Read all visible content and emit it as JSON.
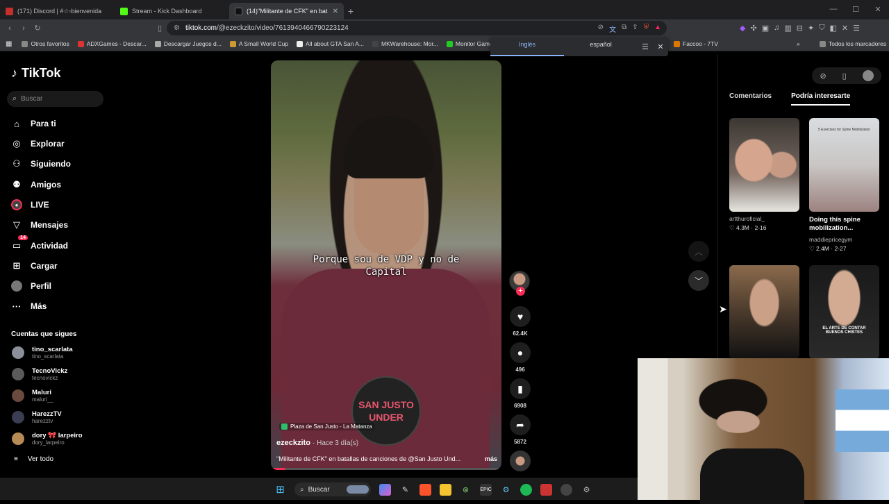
{
  "browser": {
    "tabs": [
      {
        "title": "(171) Discord | #☆▫bienvenida",
        "color": "#c4302b"
      },
      {
        "title": "Stream - Kick Dashboard",
        "color": "#53fc18"
      },
      {
        "title": "(14)\"Militante de CFK\" en bat",
        "color": "#111111",
        "active": true
      }
    ],
    "url_host": "tiktok.com",
    "url_path": "/@ezeckzito/video/7613940466790223124",
    "bookmarks": [
      "Otros favoritos",
      "ADXGames - Descar...",
      "Descargar Juegos d...",
      "A Small World Cup",
      "All about GTA San A...",
      "MKWarehouse: Mor...",
      "Monitor Gamer LE",
      "Faccoo - 7TV",
      "Todos los marcadores"
    ],
    "translate": {
      "from": "Inglés",
      "to": "español"
    }
  },
  "tiktok": {
    "logo": "TikTok",
    "search_placeholder": "Buscar",
    "nav": [
      {
        "label": "Para ti",
        "icon": "home-icon"
      },
      {
        "label": "Explorar",
        "icon": "compass-icon"
      },
      {
        "label": "Siguiendo",
        "icon": "following-icon"
      },
      {
        "label": "Amigos",
        "icon": "friends-icon"
      },
      {
        "label": "LIVE",
        "icon": "live-icon"
      },
      {
        "label": "Mensajes",
        "icon": "messages-icon"
      },
      {
        "label": "Actividad",
        "icon": "activity-icon",
        "badge": "14"
      },
      {
        "label": "Cargar",
        "icon": "upload-icon"
      },
      {
        "label": "Perfil",
        "icon": "profile-icon"
      },
      {
        "label": "Más",
        "icon": "more-icon"
      }
    ],
    "following_title": "Cuentas que sigues",
    "following": [
      {
        "name": "tino_scarlata",
        "handle": "tino_scarlata"
      },
      {
        "name": "TecnoVickz",
        "handle": "tecnovickz"
      },
      {
        "name": "Maluri",
        "handle": "maluri__"
      },
      {
        "name": "HarezzTV",
        "handle": "harezztv"
      },
      {
        "name": "dory 🎀 larpeiro",
        "handle": "dory_larpeiro"
      }
    ],
    "see_all": "Ver todo"
  },
  "video": {
    "subtitle_line1": "Porque sou de VDP y no de",
    "subtitle_line2": "Capital",
    "watermark_line1": "SAN JUSTO",
    "watermark_line2": "UNDER",
    "location": "Plaza de San Justo - La Matanza",
    "author": "ezeckzito",
    "posted": "· Hace 3 día(s)",
    "description": "\"Militante de CFK\" en batallas de canciones de @San Justo Und...",
    "more": "más",
    "progress": 0.06,
    "likes": "62.4K",
    "comments": "496",
    "saves": "6908",
    "shares": "5872"
  },
  "right_panel": {
    "tab_comments": "Comentarios",
    "tab_suggested": "Podría interesarte",
    "cards": [
      {
        "title": "",
        "user": "artthuroficial_",
        "likes": "4.3M",
        "date": "2-16"
      },
      {
        "title": "Doing this spine mobilization...",
        "thumb_text": "5 Exercises for Spine Mobilization",
        "user": "maddiepricegym",
        "likes": "2.4M",
        "date": "2-27"
      },
      {
        "title": "",
        "user": "",
        "likes": "",
        "date": ""
      },
      {
        "title": "",
        "thumb_text": "EL ARTE DE CONTAR BUENOS CHISTES",
        "user": "",
        "likes": "",
        "date": ""
      }
    ]
  },
  "taskbar": {
    "search": "Buscar"
  }
}
